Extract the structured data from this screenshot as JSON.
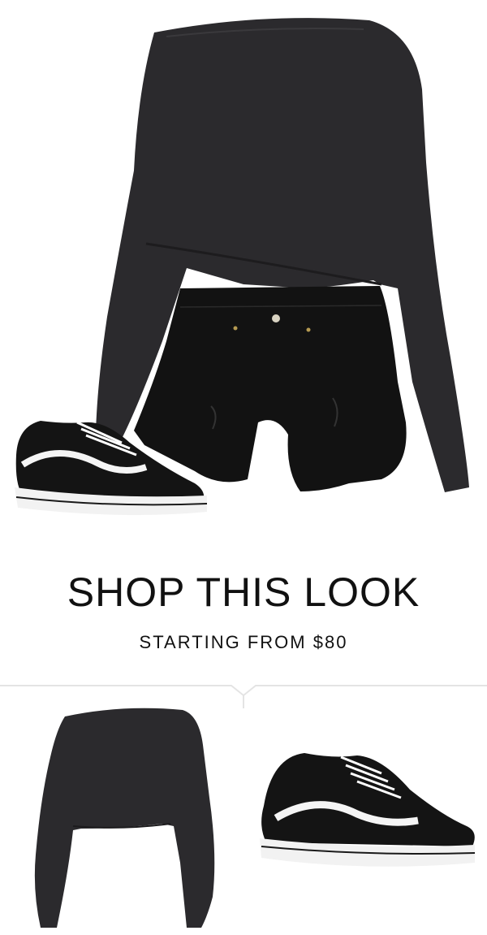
{
  "shop": {
    "title": "SHOP THIS LOOK",
    "subtitle": "STARTING FROM $80"
  },
  "colors": {
    "background": "#ffffff",
    "garment_dark": "#2b2a2d",
    "shorts_black": "#121212",
    "sneaker_black": "#141414",
    "sole_white": "#f2f2f2",
    "divider": "#e4e4e4"
  },
  "products": [
    {
      "name": "sweater-product",
      "icon": "sweater-thumbnail"
    },
    {
      "name": "sneaker-product",
      "icon": "sneaker-thumbnail"
    }
  ]
}
